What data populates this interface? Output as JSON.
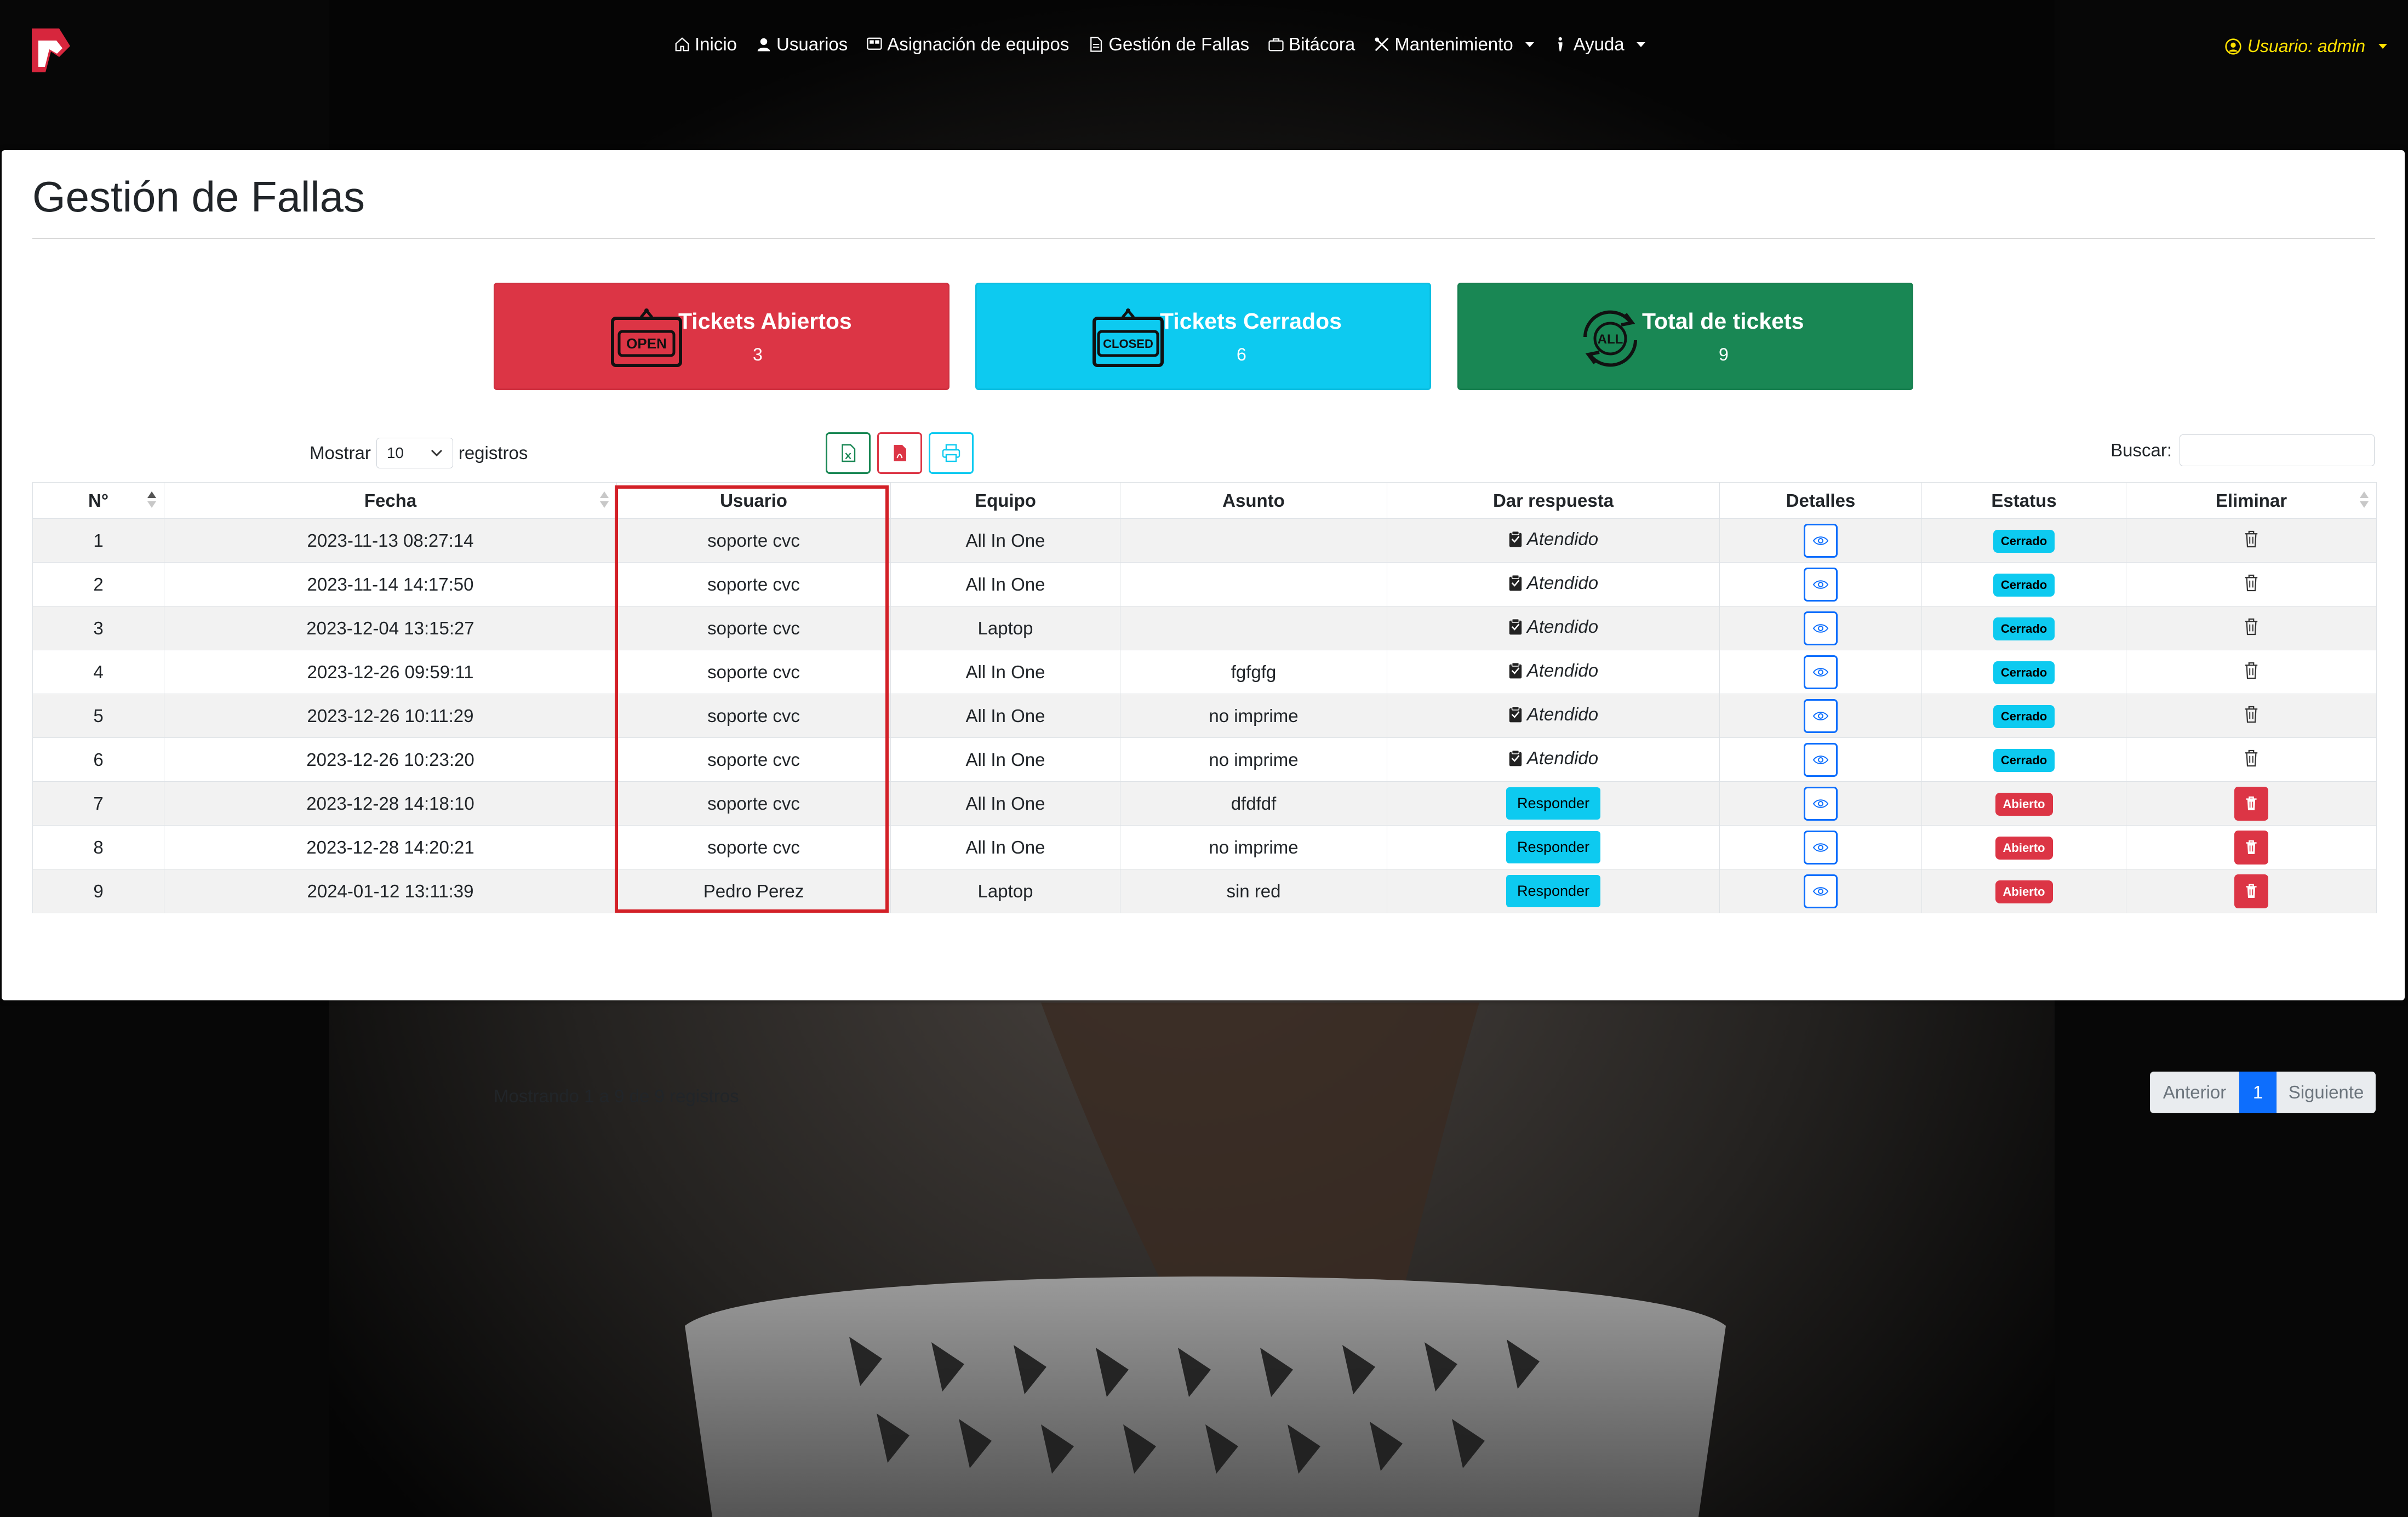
{
  "nav": {
    "items": [
      {
        "label": "Inicio",
        "icon": "home-icon"
      },
      {
        "label": "Usuarios",
        "icon": "user-icon"
      },
      {
        "label": "Asignación de equipos",
        "icon": "devices-icon"
      },
      {
        "label": "Gestión de Fallas",
        "icon": "document-icon"
      },
      {
        "label": "Bitácora",
        "icon": "briefcase-icon"
      },
      {
        "label": "Mantenimiento",
        "icon": "tools-icon",
        "dropdown": true
      },
      {
        "label": "Ayuda",
        "icon": "help-icon",
        "dropdown": true
      }
    ],
    "user_label": "Usuario: admin"
  },
  "page": {
    "title": "Gestión de Fallas"
  },
  "stats": {
    "open": {
      "label": "Tickets Abiertos",
      "count": "3",
      "color": "#dc3545"
    },
    "closed": {
      "label": "Tickets Cerrados",
      "count": "6",
      "color": "#0dcaf0"
    },
    "total": {
      "label": "Total de tickets",
      "count": "9",
      "color": "#198754"
    }
  },
  "controls": {
    "show_label": "Mostrar",
    "page_size": "10",
    "records_label": "registros",
    "search_label": "Buscar:",
    "search_value": ""
  },
  "table": {
    "headers": [
      "N°",
      "Fecha",
      "Usuario",
      "Equipo",
      "Asunto",
      "Dar respuesta",
      "Detalles",
      "Estatus",
      "Eliminar"
    ],
    "rows": [
      {
        "n": "1",
        "fecha": "2023-11-13 08:27:14",
        "usuario": "soporte cvc",
        "equipo": "All In One",
        "asunto": "",
        "respuesta": "Atendido",
        "estatus": "Cerrado"
      },
      {
        "n": "2",
        "fecha": "2023-11-14 14:17:50",
        "usuario": "soporte cvc",
        "equipo": "All In One",
        "asunto": "",
        "respuesta": "Atendido",
        "estatus": "Cerrado"
      },
      {
        "n": "3",
        "fecha": "2023-12-04 13:15:27",
        "usuario": "soporte cvc",
        "equipo": "Laptop",
        "asunto": "",
        "respuesta": "Atendido",
        "estatus": "Cerrado"
      },
      {
        "n": "4",
        "fecha": "2023-12-26 09:59:11",
        "usuario": "soporte cvc",
        "equipo": "All In One",
        "asunto": "fgfgfg",
        "respuesta": "Atendido",
        "estatus": "Cerrado"
      },
      {
        "n": "5",
        "fecha": "2023-12-26 10:11:29",
        "usuario": "soporte cvc",
        "equipo": "All In One",
        "asunto": "no imprime",
        "respuesta": "Atendido",
        "estatus": "Cerrado"
      },
      {
        "n": "6",
        "fecha": "2023-12-26 10:23:20",
        "usuario": "soporte cvc",
        "equipo": "All In One",
        "asunto": "no imprime",
        "respuesta": "Atendido",
        "estatus": "Cerrado"
      },
      {
        "n": "7",
        "fecha": "2023-12-28 14:18:10",
        "usuario": "soporte cvc",
        "equipo": "All In One",
        "asunto": "dfdfdf",
        "respuesta": "Responder",
        "estatus": "Abierto"
      },
      {
        "n": "8",
        "fecha": "2023-12-28 14:20:21",
        "usuario": "soporte cvc",
        "equipo": "All In One",
        "asunto": "no imprime",
        "respuesta": "Responder",
        "estatus": "Abierto"
      },
      {
        "n": "9",
        "fecha": "2024-01-12 13:11:39",
        "usuario": "Pedro Perez",
        "equipo": "Laptop",
        "asunto": "sin red",
        "respuesta": "Responder",
        "estatus": "Abierto"
      }
    ]
  },
  "footer": {
    "info": "Mostrando 1 a 9 de 9 registros",
    "prev_label": "Anterior",
    "current_page": "1",
    "next_label": "Siguiente"
  },
  "colors": {
    "accent_blue": "#0d6efd",
    "danger": "#dc3545",
    "info": "#0dcaf0",
    "success": "#198754",
    "user_label": "#ffe100",
    "highlight_box": "#d32027"
  }
}
